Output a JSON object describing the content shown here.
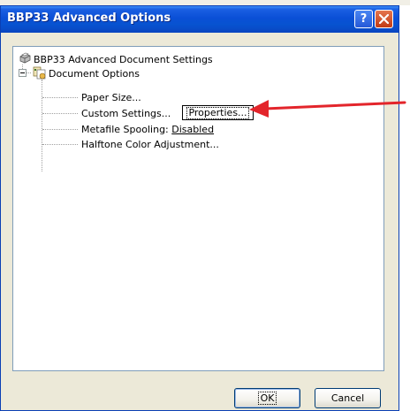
{
  "window": {
    "title": "BBP33 Advanced Options",
    "help_label": "?",
    "colors": {
      "titlebar": "#0a4fd6",
      "body": "#ece9d8",
      "arrow": "#e3252b"
    }
  },
  "tree": {
    "root_label": "BBP33 Advanced Document Settings",
    "group_label": "Document Options",
    "items": [
      {
        "label": "Paper Size..."
      },
      {
        "label": "Custom Settings...",
        "button_label": "Properties..."
      },
      {
        "label": "Metafile Spooling:",
        "value": "Disabled"
      },
      {
        "label": "Halftone Color Adjustment..."
      }
    ],
    "icons": {
      "root": "printer-icon",
      "group": "document-options-icon"
    }
  },
  "buttons": {
    "ok_label": "OK",
    "cancel_label": "Cancel"
  }
}
